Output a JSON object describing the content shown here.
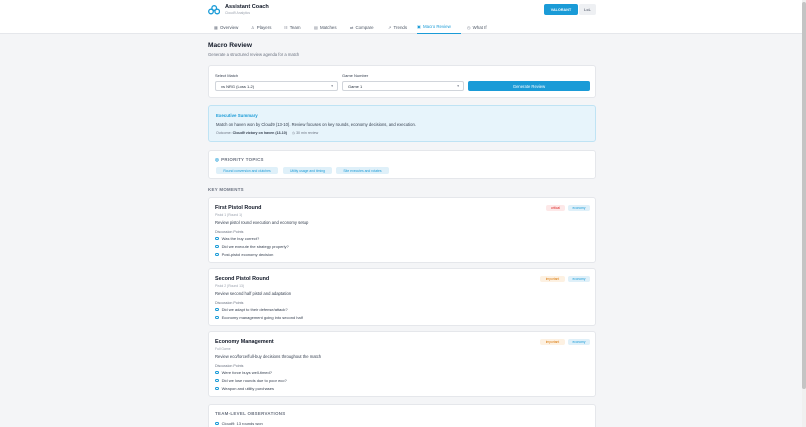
{
  "app": {
    "title": "Assistant Coach",
    "subtitle": "Cloud9 Analytics"
  },
  "games": {
    "active": "VALORANT",
    "inactive": "LoL"
  },
  "nav": [
    {
      "icon": "▦",
      "label": "Overview"
    },
    {
      "icon": "♙",
      "label": "Players"
    },
    {
      "icon": "☷",
      "label": "Team"
    },
    {
      "icon": "▤",
      "label": "Matches"
    },
    {
      "icon": "⇄",
      "label": "Compare"
    },
    {
      "icon": "↗",
      "label": "Trends"
    },
    {
      "icon": "▣",
      "label": "Macro Review"
    },
    {
      "icon": "◷",
      "label": "What If"
    }
  ],
  "page": {
    "title": "Macro Review",
    "subtitle": "Generate a structured review agenda for a match"
  },
  "form": {
    "match_label": "Select Match",
    "match_value": "vs NRG (Loss 1-2)",
    "game_label": "Game Number",
    "game_value": "Game 1",
    "generate_label": "Generate Review"
  },
  "summary": {
    "title": "Executive Summary",
    "text": "Match on haven won by Cloud9 (13-10). Review focuses on key rounds, economy decisions, and execution.",
    "outcome_prefix": "Outcome:",
    "outcome_value": "Cloud9 victory on haven (13-10)",
    "duration": "30 min review"
  },
  "priority": {
    "title": "PRIORITY TOPICS",
    "topics": [
      "Round conversion and clutches",
      "Utility usage and timing",
      "Site executes and rotates"
    ]
  },
  "key_moments_title": "KEY MOMENTS",
  "moments": [
    {
      "title": "First Pistol Round",
      "meta": "Pistol 1 (Round 1)",
      "badges": [
        "critical",
        "economy"
      ],
      "description": "Review pistol round execution and economy setup",
      "dp_label": "Discussion Points",
      "points": [
        "Was the buy correct?",
        "Did we execute the strategy properly?",
        "Post-pistol economy decision"
      ]
    },
    {
      "title": "Second Pistol Round",
      "meta": "Pistol 2 (Round 13)",
      "badges": [
        "important",
        "economy"
      ],
      "description": "Review second half pistol and adaptation",
      "dp_label": "Discussion Points",
      "points": [
        "Did we adapt to their defense/attack?",
        "Economy management going into second half"
      ]
    },
    {
      "title": "Economy Management",
      "meta": "Full Game",
      "badges": [
        "important",
        "economy"
      ],
      "description": "Review eco/force/full-buy decisions throughout the match",
      "dp_label": "Discussion Points",
      "points": [
        "Were force buys well-timed?",
        "Did we lose rounds due to poor eco?",
        "Weapon and utility purchases"
      ]
    }
  ],
  "observations": {
    "title": "TEAM-LEVEL OBSERVATIONS",
    "items": [
      "Cloud9: 13 rounds won"
    ]
  },
  "colors": {
    "accent": "#1a9bd7",
    "critical": "#dc2626",
    "important": "#d97706"
  }
}
